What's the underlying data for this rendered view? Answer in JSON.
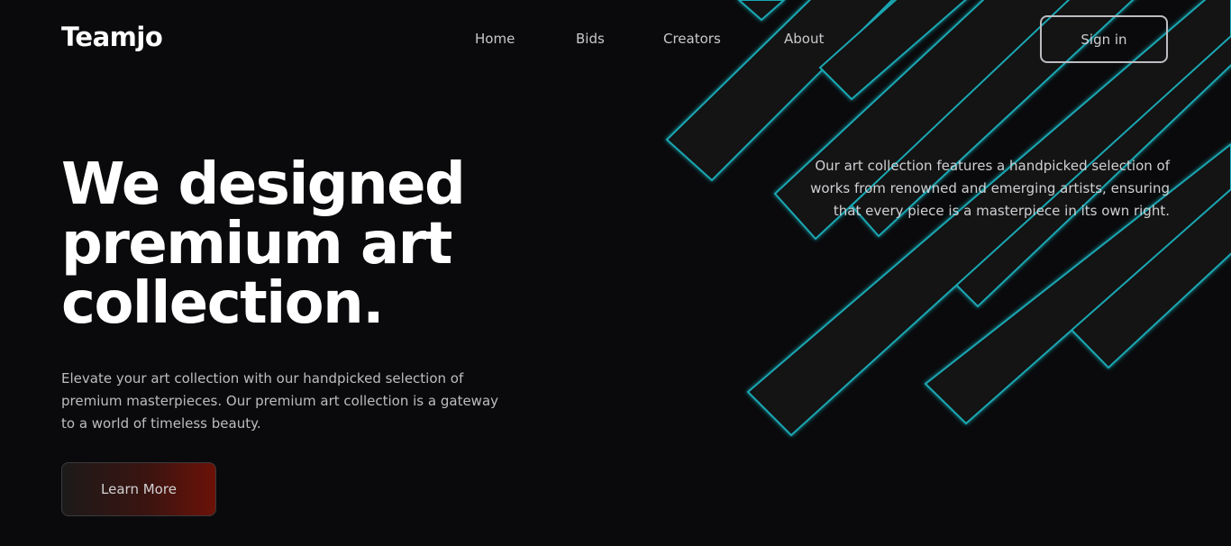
{
  "brand": {
    "logo": "Teamjo"
  },
  "nav": {
    "items": [
      {
        "label": "Home"
      },
      {
        "label": "Bids"
      },
      {
        "label": "Creators"
      },
      {
        "label": "About"
      }
    ],
    "signin_label": "Sign in"
  },
  "hero": {
    "title_line1": "We designed",
    "title_line2": "premium art",
    "title_line3": "collection.",
    "description": "Elevate your art collection with our handpicked selection of premium masterpieces. Our premium art collection is a gateway to a world of timeless beauty.",
    "cta_label": "Learn More",
    "side_text": "Our art collection features a handpicked selection of works from renowned and emerging artists, ensuring that every piece is a masterpiece in its own right."
  },
  "colors": {
    "background": "#0a0a0c",
    "accent_glow": "#1fb8c4",
    "cta_gradient_end": "#6b1208"
  }
}
